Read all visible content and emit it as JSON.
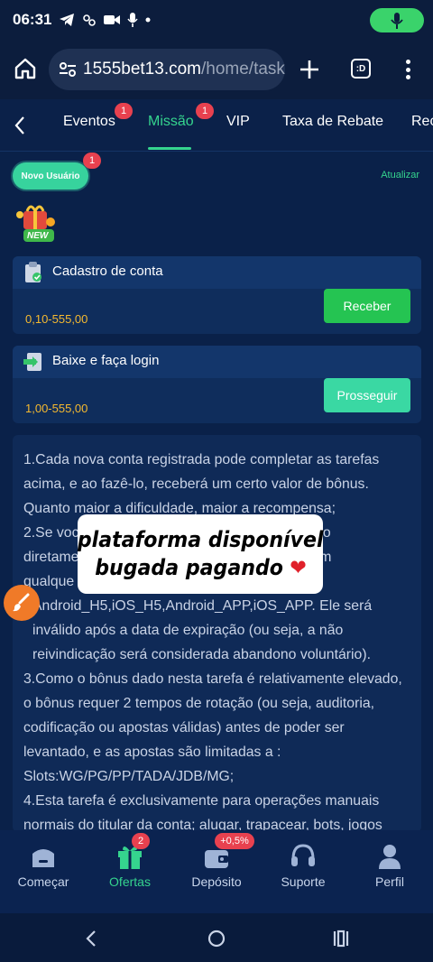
{
  "status_bar": {
    "time": "06:31"
  },
  "browser": {
    "url_domain": "1555bet13.com",
    "url_path": "/home/task?",
    "tabs_icon_label": ":D"
  },
  "tabs": [
    {
      "label": "Eventos",
      "badge": "1"
    },
    {
      "label": "Missão",
      "badge": "1",
      "active": true
    },
    {
      "label": "VIP"
    },
    {
      "label": "Taxa de Rebate"
    },
    {
      "label": "Rec"
    }
  ],
  "chips": {
    "novo_usuario": "Novo Usuário",
    "novo_badge": "1",
    "atualizar": "Atualizar"
  },
  "gift_new_label": "NEW",
  "tasks": [
    {
      "title": "Cadastro de conta",
      "amount": "0,10-555,00",
      "button": "Receber",
      "icon": "clipboard-icon"
    },
    {
      "title": "Baixe e faça login",
      "amount": "1,00-555,00",
      "button": "Prosseguir",
      "icon": "download-icon"
    }
  ],
  "rules": [
    "1.Cada nova conta registrada pode completar as tarefas acima, e ao fazê-lo, receberá um certo valor de bônus. Quanto maior a dificuldade, maior a recompensa;",
    "2.Se voc",
    "rebê-lo",
    "diretame",
    "em",
    "qualque",
    "Android_H5,iOS_H5,Android_APP,iOS_APP. Ele será inválido após a data de expiração (ou seja, a não reivindicação será considerada abandono voluntário).",
    "3.Como o bônus dado nesta tarefa é relativamente elevado, o bônus requer 2 tempos de rotação (ou seja, auditoria, codificação ou apostas válidas) antes de poder ser levantado, e as apostas são limitadas a : Slots:WG/PG/PP/TADA/JDB/MG;",
    "4.Esta tarefa é exclusivamente para operações manuais normais do titular da conta; alugar, trapacear, bots, jogos"
  ],
  "sticker": {
    "line1": "plataforma disponível",
    "line2": "bugada pagando",
    "emoji": "❤️"
  },
  "bottom_nav": [
    {
      "label": "Começar",
      "icon": "home-icon"
    },
    {
      "label": "Ofertas",
      "icon": "gift-icon",
      "badge": "2",
      "active": true
    },
    {
      "label": "Depósito",
      "icon": "wallet-icon",
      "badge": "+0,5%"
    },
    {
      "label": "Suporte",
      "icon": "headset-icon"
    },
    {
      "label": "Perfil",
      "icon": "user-icon"
    }
  ],
  "colors": {
    "accent": "#35d48e",
    "badge": "#e8414f",
    "amount": "#f5b930",
    "background": "#0a2149"
  }
}
